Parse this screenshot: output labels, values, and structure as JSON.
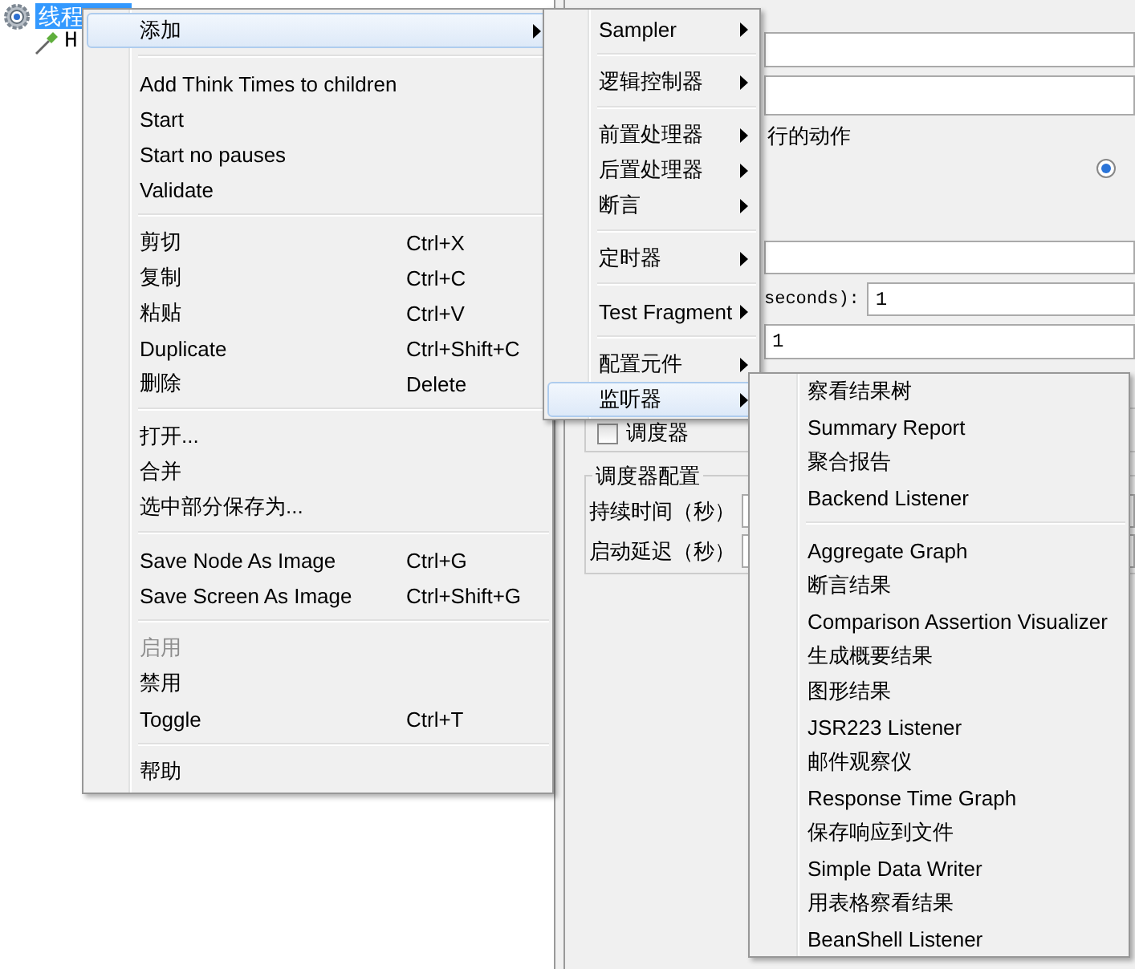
{
  "tree": {
    "nodes": [
      {
        "label": "线程",
        "selected": true,
        "kind": "group"
      },
      {
        "label": "H",
        "selected": false,
        "kind": "sampler"
      }
    ]
  },
  "panel": {
    "action_group": "行的动作",
    "action_radio": {
      "checked": true
    },
    "duration_label": "seconds):",
    "duration_value": "1",
    "loop_value": "1",
    "scheduler": {
      "label": "调度器",
      "checked": false
    },
    "scheduler_config": {
      "title": "调度器配置",
      "fields": [
        "持续时间（秒）",
        "启动延迟（秒）"
      ]
    }
  },
  "menus": [
    {
      "items": [
        {
          "kind": "item",
          "label": "添加",
          "submenu": true,
          "selected": true,
          "disabled": false
        },
        {
          "kind": "separator"
        },
        {
          "kind": "item",
          "label": "Add Think Times to children",
          "submenu": false,
          "selected": false,
          "disabled": false
        },
        {
          "kind": "item",
          "label": "Start",
          "submenu": false,
          "selected": false,
          "disabled": false
        },
        {
          "kind": "item",
          "label": "Start no pauses",
          "submenu": false,
          "selected": false,
          "disabled": false
        },
        {
          "kind": "item",
          "label": "Validate",
          "submenu": false,
          "selected": false,
          "disabled": false
        },
        {
          "kind": "separator"
        },
        {
          "kind": "item",
          "label": "剪切",
          "shortcut": "Ctrl+X",
          "submenu": false,
          "selected": false,
          "disabled": false
        },
        {
          "kind": "item",
          "label": "复制",
          "shortcut": "Ctrl+C",
          "submenu": false,
          "selected": false,
          "disabled": false
        },
        {
          "kind": "item",
          "label": "粘贴",
          "shortcut": "Ctrl+V",
          "submenu": false,
          "selected": false,
          "disabled": false
        },
        {
          "kind": "item",
          "label": "Duplicate",
          "shortcut": "Ctrl+Shift+C",
          "submenu": false,
          "selected": false,
          "disabled": false
        },
        {
          "kind": "item",
          "label": "删除",
          "shortcut": "Delete",
          "submenu": false,
          "selected": false,
          "disabled": false
        },
        {
          "kind": "separator"
        },
        {
          "kind": "item",
          "label": "打开...",
          "submenu": false,
          "selected": false,
          "disabled": false
        },
        {
          "kind": "item",
          "label": "合并",
          "submenu": false,
          "selected": false,
          "disabled": false
        },
        {
          "kind": "item",
          "label": "选中部分保存为...",
          "submenu": false,
          "selected": false,
          "disabled": false
        },
        {
          "kind": "separator"
        },
        {
          "kind": "item",
          "label": "Save Node As Image",
          "shortcut": "Ctrl+G",
          "submenu": false,
          "selected": false,
          "disabled": false
        },
        {
          "kind": "item",
          "label": "Save Screen As Image",
          "shortcut": "Ctrl+Shift+G",
          "submenu": false,
          "selected": false,
          "disabled": false
        },
        {
          "kind": "separator"
        },
        {
          "kind": "item",
          "label": "启用",
          "submenu": false,
          "selected": false,
          "disabled": true
        },
        {
          "kind": "item",
          "label": "禁用",
          "submenu": false,
          "selected": false,
          "disabled": false
        },
        {
          "kind": "item",
          "label": "Toggle",
          "shortcut": "Ctrl+T",
          "submenu": false,
          "selected": false,
          "disabled": false
        },
        {
          "kind": "separator"
        },
        {
          "kind": "item",
          "label": "帮助",
          "submenu": false,
          "selected": false,
          "disabled": false
        }
      ]
    },
    {
      "items": [
        {
          "kind": "item",
          "label": "Sampler",
          "submenu": true,
          "selected": false,
          "disabled": false
        },
        {
          "kind": "separator"
        },
        {
          "kind": "item",
          "label": "逻辑控制器",
          "submenu": true,
          "selected": false,
          "disabled": false
        },
        {
          "kind": "separator"
        },
        {
          "kind": "item",
          "label": "前置处理器",
          "submenu": true,
          "selected": false,
          "disabled": false
        },
        {
          "kind": "item",
          "label": "后置处理器",
          "submenu": true,
          "selected": false,
          "disabled": false
        },
        {
          "kind": "item",
          "label": "断言",
          "submenu": true,
          "selected": false,
          "disabled": false
        },
        {
          "kind": "separator"
        },
        {
          "kind": "item",
          "label": "定时器",
          "submenu": true,
          "selected": false,
          "disabled": false
        },
        {
          "kind": "separator"
        },
        {
          "kind": "item",
          "label": "Test Fragment",
          "submenu": true,
          "selected": false,
          "disabled": false
        },
        {
          "kind": "separator"
        },
        {
          "kind": "item",
          "label": "配置元件",
          "submenu": true,
          "selected": false,
          "disabled": false
        },
        {
          "kind": "item",
          "label": "监听器",
          "submenu": true,
          "selected": true,
          "disabled": false
        }
      ]
    },
    {
      "items": [
        {
          "kind": "item",
          "label": "察看结果树",
          "submenu": false,
          "selected": false,
          "disabled": false
        },
        {
          "kind": "item",
          "label": "Summary Report",
          "submenu": false,
          "selected": false,
          "disabled": false
        },
        {
          "kind": "item",
          "label": "聚合报告",
          "submenu": false,
          "selected": false,
          "disabled": false
        },
        {
          "kind": "item",
          "label": "Backend Listener",
          "submenu": false,
          "selected": false,
          "disabled": false
        },
        {
          "kind": "separator"
        },
        {
          "kind": "item",
          "label": "Aggregate Graph",
          "submenu": false,
          "selected": false,
          "disabled": false
        },
        {
          "kind": "item",
          "label": "断言结果",
          "submenu": false,
          "selected": false,
          "disabled": false
        },
        {
          "kind": "item",
          "label": "Comparison Assertion Visualizer",
          "submenu": false,
          "selected": false,
          "disabled": false
        },
        {
          "kind": "item",
          "label": "生成概要结果",
          "submenu": false,
          "selected": false,
          "disabled": false
        },
        {
          "kind": "item",
          "label": "图形结果",
          "submenu": false,
          "selected": false,
          "disabled": false
        },
        {
          "kind": "item",
          "label": "JSR223 Listener",
          "submenu": false,
          "selected": false,
          "disabled": false
        },
        {
          "kind": "item",
          "label": "邮件观察仪",
          "submenu": false,
          "selected": false,
          "disabled": false
        },
        {
          "kind": "item",
          "label": "Response Time Graph",
          "submenu": false,
          "selected": false,
          "disabled": false
        },
        {
          "kind": "item",
          "label": "保存响应到文件",
          "submenu": false,
          "selected": false,
          "disabled": false
        },
        {
          "kind": "item",
          "label": "Simple Data Writer",
          "submenu": false,
          "selected": false,
          "disabled": false
        },
        {
          "kind": "item",
          "label": "用表格察看结果",
          "submenu": false,
          "selected": false,
          "disabled": false
        },
        {
          "kind": "item",
          "label": "BeanShell Listener",
          "submenu": false,
          "selected": false,
          "disabled": false
        }
      ]
    }
  ]
}
